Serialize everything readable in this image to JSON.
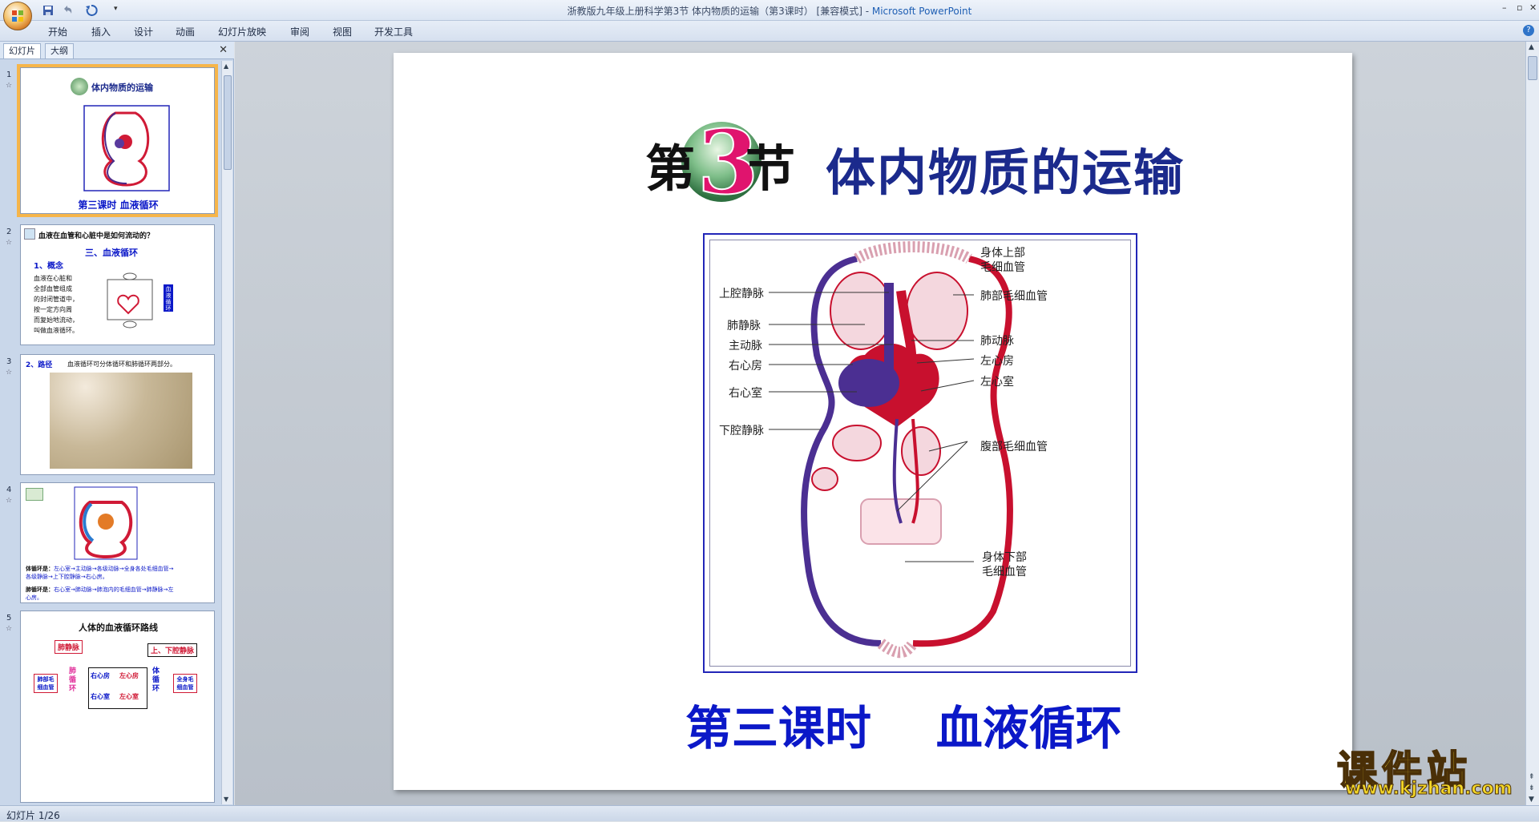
{
  "window": {
    "title": "浙教版九年级上册科学第3节 体内物质的运输（第3课时） [兼容模式] - ",
    "app_name": "Microsoft PowerPoint"
  },
  "ribbon": {
    "tabs": [
      "开始",
      "插入",
      "设计",
      "动画",
      "幻灯片放映",
      "审阅",
      "视图",
      "开发工具"
    ]
  },
  "left_panel": {
    "tabs": [
      "幻灯片",
      "大纲"
    ],
    "slides": [
      {
        "num": "1",
        "title": "体内物质的运输",
        "caption": "第三课时  血液循环"
      },
      {
        "num": "2",
        "heading": "血液在血管和心脏中是如何流动的？",
        "subtitle": "三、血液循环",
        "point": "1、概念",
        "body": [
          "血液在心脏和",
          "全部血管组成",
          "的封闭管道中，",
          "按一定方向周",
          "而复始地流动，",
          "叫做血液循环。"
        ],
        "side": "血液循环"
      },
      {
        "num": "3",
        "heading": "2、路径",
        "body": "血液循环可分体循环和肺循环两部分。"
      },
      {
        "num": "4",
        "text1_label": "体循环是：",
        "text1": "左心室→主动脉→各级动脉→全身各处毛细血管→各级静脉→上下腔静脉→右心房。",
        "text2_label": "肺循环是：",
        "text2": "右心室→肺动脉→肺泡内的毛细血管→肺静脉→左心房。"
      },
      {
        "num": "5",
        "heading": "人体的血液循环路线",
        "box1": "肺静脉",
        "box2": "上、下腔静脉",
        "box3": "肺部毛细血管",
        "box4": "右心房",
        "box5": "左心房",
        "box6": "右心室",
        "box7": "左心室",
        "box8": "全身毛细血管",
        "label1": "肺循环",
        "label2": "体循环"
      }
    ]
  },
  "slide": {
    "section_char1": "第",
    "section_num": "3",
    "section_char2": "节",
    "title": "体内物质的运输",
    "lesson": "第三课时    血液循环",
    "diagram_labels": {
      "upper_body_cap": [
        "身体上部",
        "毛细血管"
      ],
      "lung_cap": "肺部毛细血管",
      "svc": "上腔静脉",
      "pulm_vein": "肺静脉",
      "aorta": "主动脉",
      "pulm_artery": "肺动脉",
      "right_atrium": "右心房",
      "left_atrium": "左心房",
      "right_ventricle": "右心室",
      "left_ventricle": "左心室",
      "ivc": "下腔静脉",
      "abdomen_cap": "腹部毛细血管",
      "lower_body_cap": [
        "身体下部",
        "毛细血管"
      ]
    }
  },
  "status": {
    "slide_counter": "幻灯片 1/26"
  },
  "watermark": {
    "main": "课件站",
    "sub": "www.kjzhan.com"
  }
}
